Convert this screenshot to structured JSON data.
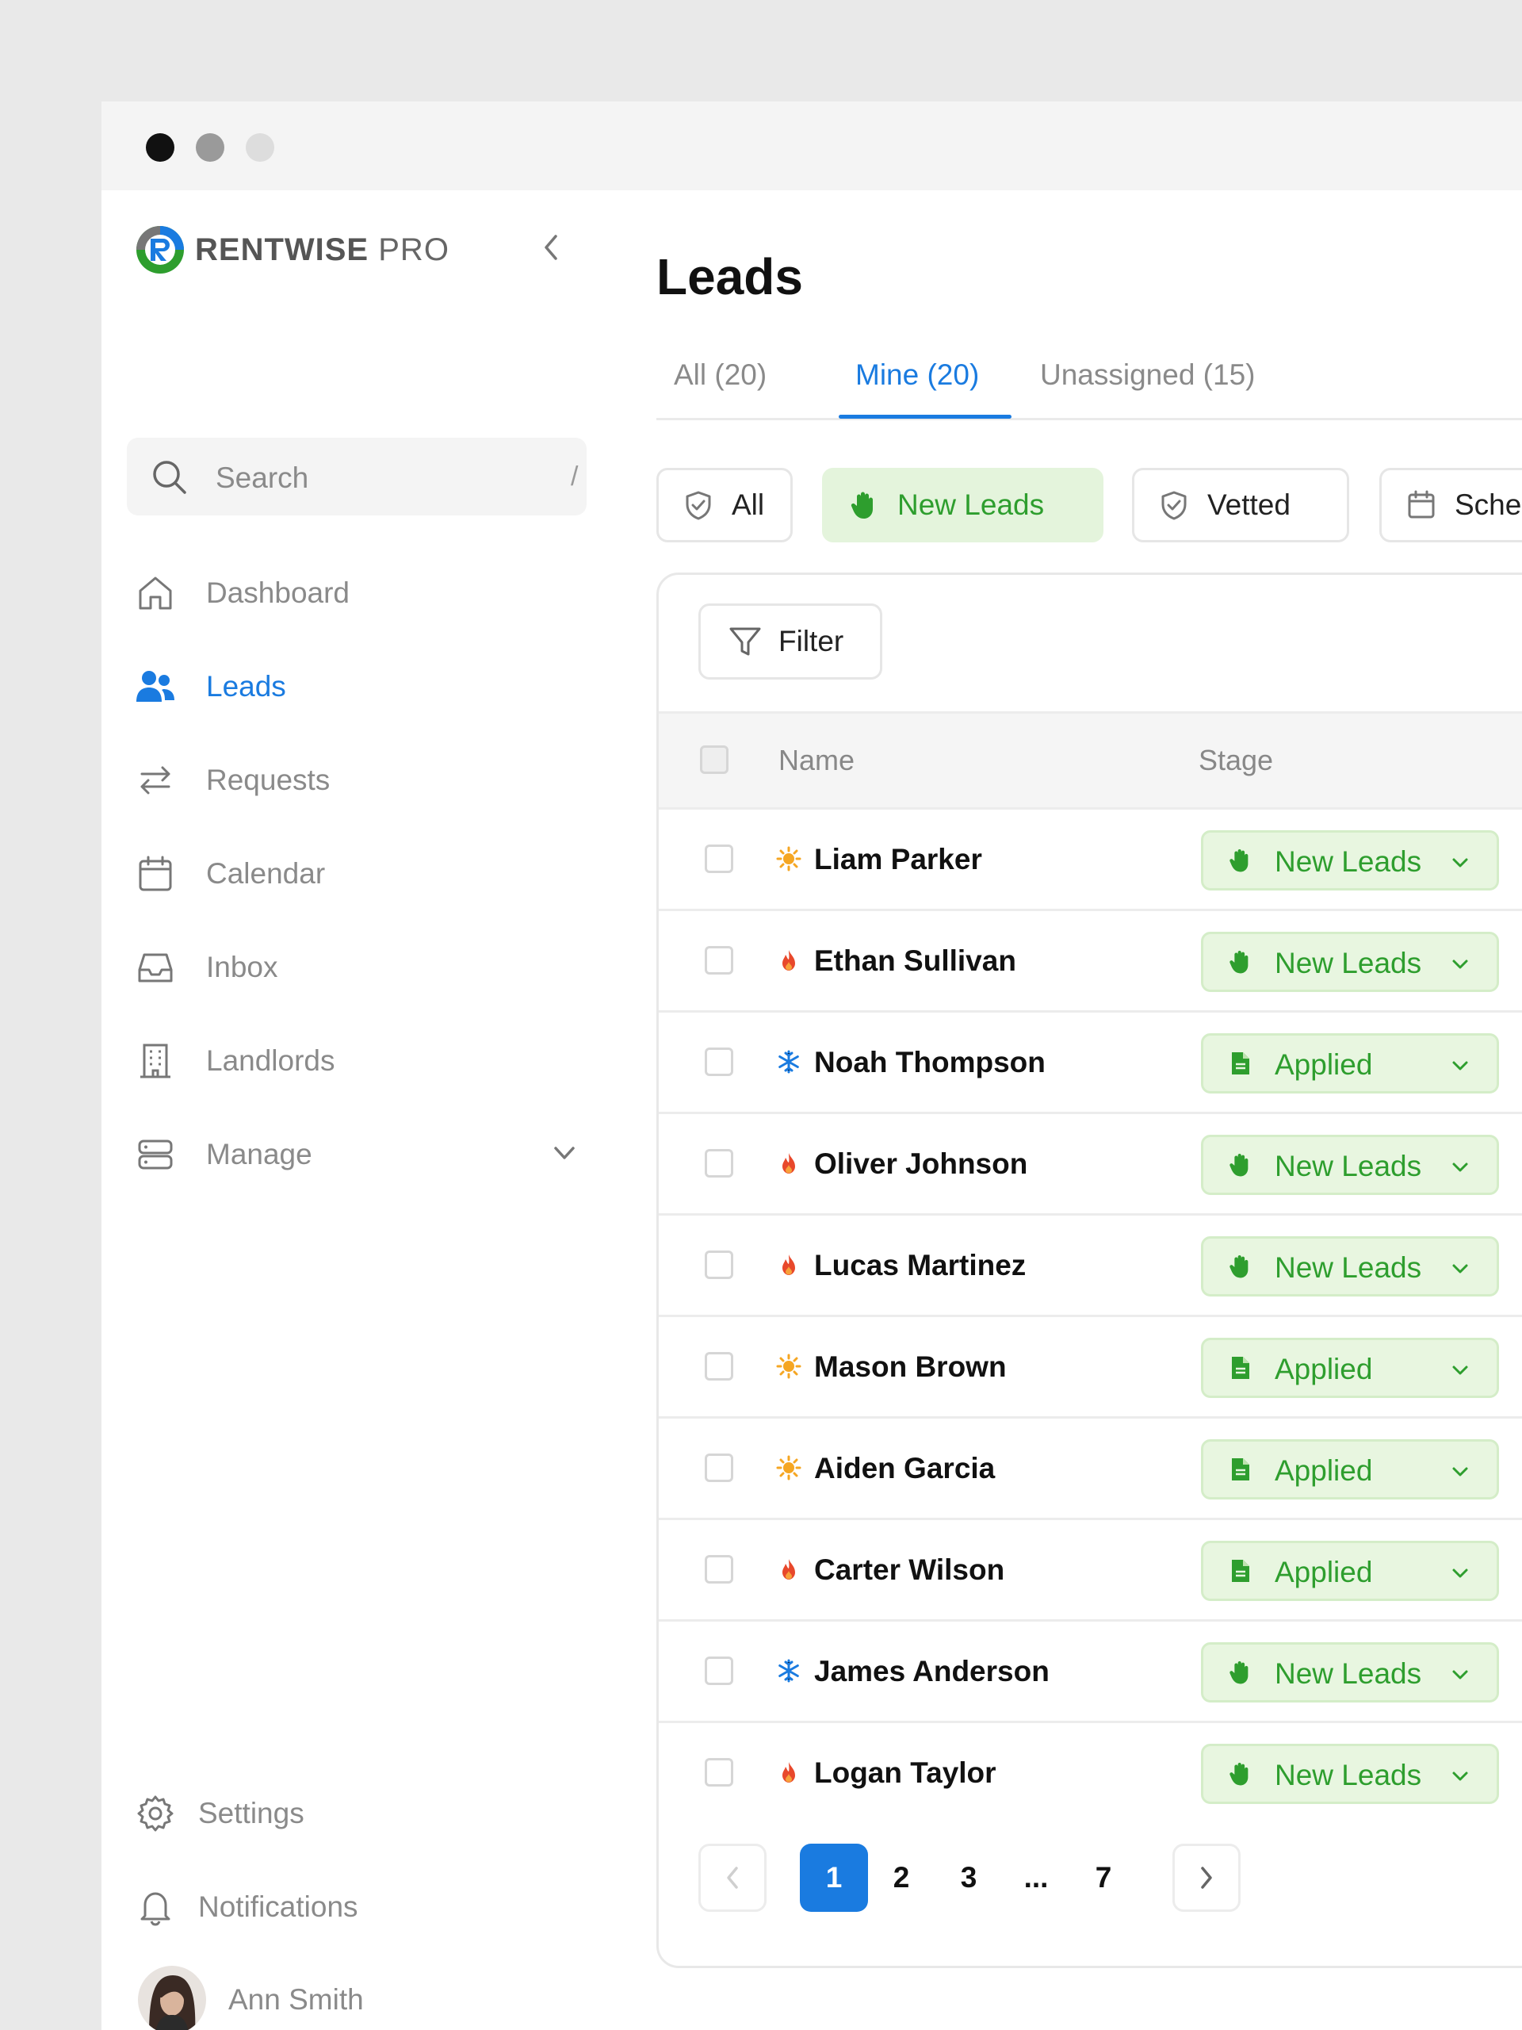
{
  "colors": {
    "accent": "#1a7be0",
    "stage_green": "#2e9e2e",
    "stage_bg": "#e8f6e0"
  },
  "window": {
    "dots": [
      "#111111",
      "#9a9a9a",
      "#dddddd"
    ]
  },
  "sidebar": {
    "brand_name": "RENTWISE",
    "brand_suffix": "PRO",
    "search": {
      "placeholder": "Search",
      "shortcut": "/"
    },
    "items": [
      {
        "label": "Dashboard",
        "icon": "home-icon"
      },
      {
        "label": "Leads",
        "icon": "users-icon",
        "active": true
      },
      {
        "label": "Requests",
        "icon": "arrows-swap-icon"
      },
      {
        "label": "Calendar",
        "icon": "calendar-icon"
      },
      {
        "label": "Inbox",
        "icon": "inbox-icon"
      },
      {
        "label": "Landlords",
        "icon": "building-icon"
      },
      {
        "label": "Manage",
        "icon": "database-icon"
      }
    ],
    "settings_label": "Settings",
    "notifications_label": "Notifications",
    "user_name": "Ann Smith"
  },
  "main": {
    "title": "Leads",
    "tabs": [
      {
        "label": "All (20)"
      },
      {
        "label": "Mine (20)",
        "active": true
      },
      {
        "label": "Unassigned (15)"
      }
    ],
    "chips": [
      {
        "label": "All",
        "icon": "shield-check-icon"
      },
      {
        "label": "New Leads",
        "icon": "hand-wave-icon",
        "active": true
      },
      {
        "label": "Vetted",
        "icon": "shield-check-icon"
      },
      {
        "label": "Sche",
        "icon": "calendar-icon"
      }
    ],
    "filter_label": "Filter",
    "table": {
      "headers": {
        "name": "Name",
        "stage": "Stage"
      },
      "rows": [
        {
          "name": "Liam Parker",
          "temp": "sun",
          "stage": "New Leads"
        },
        {
          "name": "Ethan Sullivan",
          "temp": "fire",
          "stage": "New Leads"
        },
        {
          "name": "Noah Thompson",
          "temp": "snow",
          "stage": "Applied"
        },
        {
          "name": "Oliver Johnson",
          "temp": "fire",
          "stage": "New Leads"
        },
        {
          "name": "Lucas Martinez",
          "temp": "fire",
          "stage": "New Leads"
        },
        {
          "name": "Mason Brown",
          "temp": "sun",
          "stage": "Applied"
        },
        {
          "name": "Aiden Garcia",
          "temp": "sun",
          "stage": "Applied"
        },
        {
          "name": "Carter Wilson",
          "temp": "fire",
          "stage": "Applied"
        },
        {
          "name": "James Anderson",
          "temp": "snow",
          "stage": "New Leads"
        },
        {
          "name": "Logan Taylor",
          "temp": "fire",
          "stage": "New Leads"
        }
      ]
    },
    "pagination": {
      "pages": [
        "1",
        "2",
        "3",
        "...",
        "7"
      ],
      "current": "1"
    }
  }
}
